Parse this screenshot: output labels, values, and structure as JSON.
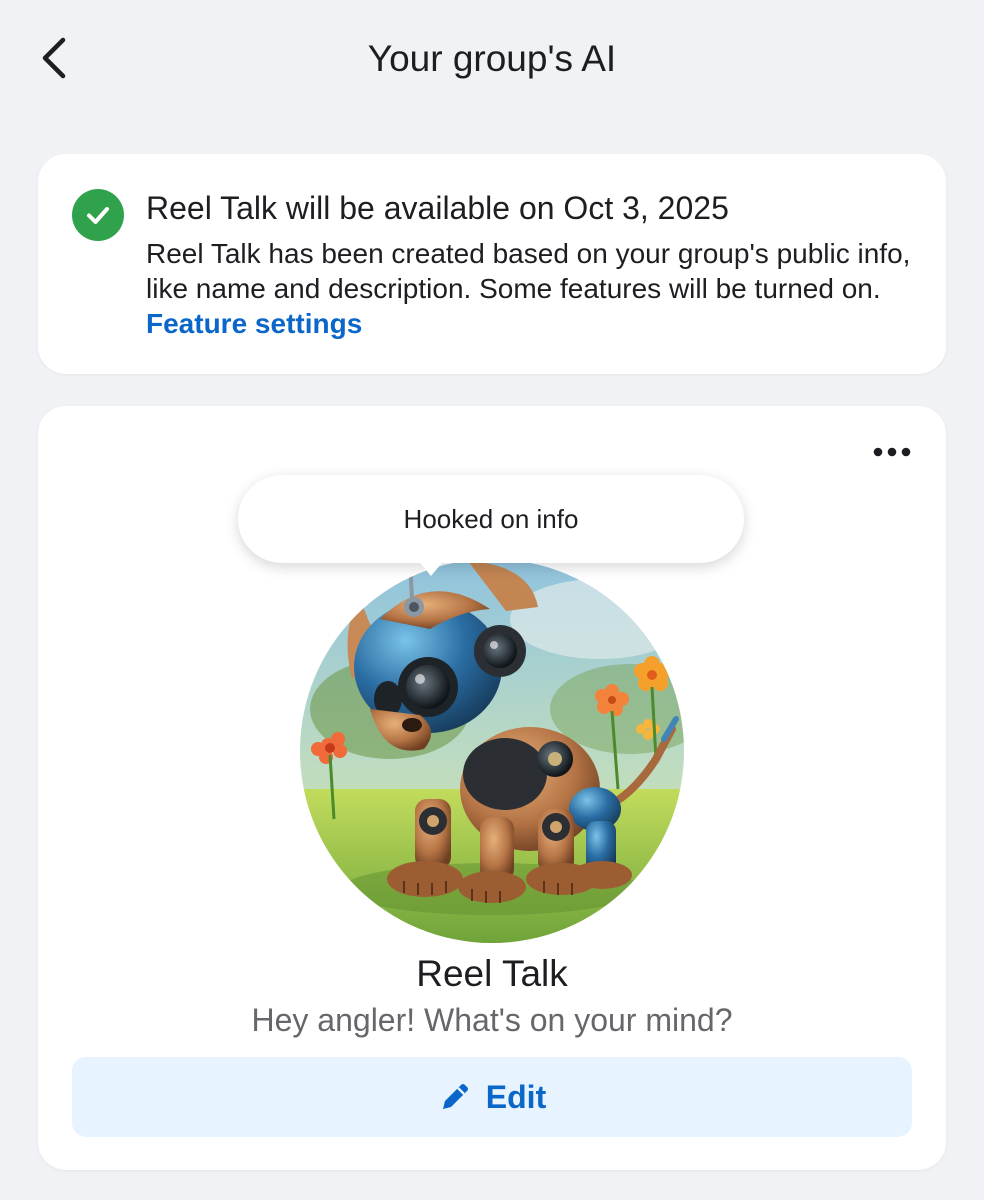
{
  "header": {
    "title": "Your group's AI",
    "back_icon": "chevron-left-icon"
  },
  "notice": {
    "icon": "check-circle-icon",
    "icon_color": "#31a24c",
    "title": "Reel Talk will be available on Oct 3, 2025",
    "body": "Reel Talk has been created based on your group's public info, like name and description. Some features will be turned on. ",
    "link_label": "Feature settings",
    "link_color": "#0a66c8"
  },
  "ai_card": {
    "more_icon": "more-horizontal-icon",
    "bubble_text": "Hooked on info",
    "avatar": "robot-dog-avatar",
    "name": "Reel Talk",
    "greeting": "Hey angler! What's on your mind?",
    "edit_label": "Edit",
    "edit_icon": "pencil-icon",
    "edit_bg": "#e7f3ff"
  }
}
